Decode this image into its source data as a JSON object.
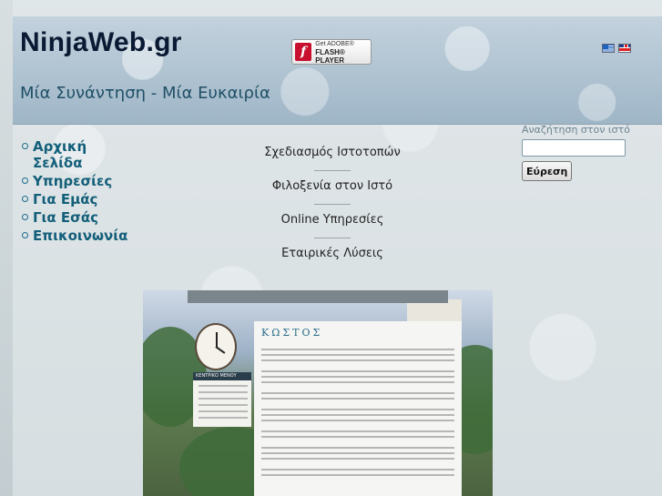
{
  "header": {
    "site_title": "NinjaWeb.gr",
    "tagline": "Μία Συνάντηση - Μία Ευκαιρία",
    "flash_badge": {
      "line1": "Get ADOBE®",
      "line2": "FLASH® PLAYER",
      "icon": "flash-f-icon"
    },
    "languages": [
      {
        "name": "greek-flag-icon"
      },
      {
        "name": "english-flag-icon"
      }
    ]
  },
  "nav": {
    "items": [
      {
        "label": "Αρχική Σελίδα"
      },
      {
        "label": "Υπηρεσίες"
      },
      {
        "label": "Για Εμάς"
      },
      {
        "label": "Για Εσάς"
      },
      {
        "label": "Επικοινωνία"
      }
    ]
  },
  "services": {
    "items": [
      {
        "label": "Σχεδιασμός Ιστοτοπών"
      },
      {
        "label": "Φιλοξενία στον Ιστό"
      },
      {
        "label": "Online Υπηρεσίες"
      },
      {
        "label": "Εταιρικές Λύσεις"
      }
    ]
  },
  "search": {
    "label": "Αναζήτηση στον ιστό",
    "value": "",
    "button_label": "Εύρεση"
  },
  "preview": {
    "content_title": "ΚΩΣΤΟΣ",
    "menu_header": "ΚΕΝΤΡΙΚΟ ΜΕΝΟΥ"
  },
  "colors": {
    "nav_link": "#135f7a",
    "title": "#0b1a33",
    "tagline": "#1f4f66"
  }
}
